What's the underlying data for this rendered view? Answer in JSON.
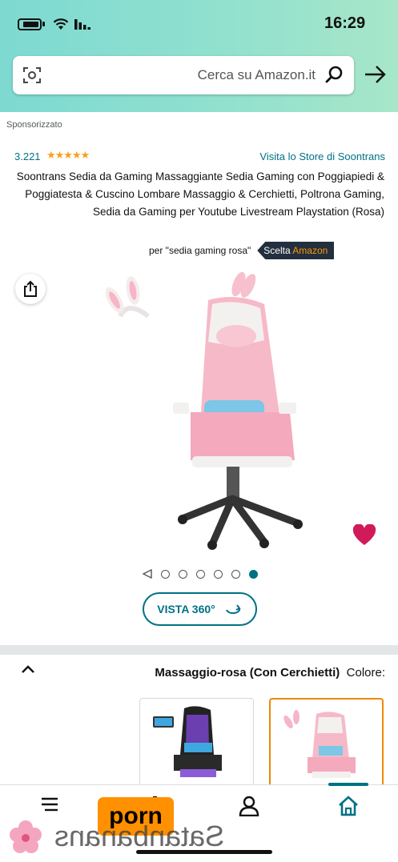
{
  "status_bar": {
    "time": "16:29"
  },
  "search": {
    "placeholder": "Cerca su Amazon.it"
  },
  "sponsor_label": "Sponsorizzato",
  "store_link": "Visita lo Store di Soontrans",
  "rating": {
    "stars": "★★★★★",
    "value": 4.5,
    "count": "3.221"
  },
  "product_title": "Soontrans Sedia da Gaming Massaggiante Sedia Gaming con Poggiapiedi & Poggiatesta & Cuscino Lombare Massaggio & Cerchietti, Poltrona Gaming, Sedia da Gaming per Youtube Livestream Playstation (Rosa)",
  "choice": {
    "badge_prefix": "Scelta ",
    "badge_brand": "Amazon",
    "query_text": "per \"sedia gaming rosa\""
  },
  "carousel": {
    "dot_count": 6,
    "active_index": 0
  },
  "view360": {
    "label": "VISTA 360°"
  },
  "variation": {
    "label": "Colore:",
    "value": "Massaggio-rosa (Con Cerchietti)"
  },
  "watermark": {
    "site": "porn",
    "name": "Satanbanans"
  },
  "colors": {
    "accent": "#007185",
    "badge_bg": "#232f3e",
    "brand": "#ff9900",
    "heart": "#d11a5a",
    "header": "#8ee0cf"
  },
  "icons": [
    "battery-icon",
    "wifi-icon",
    "signal-icon",
    "camera-icon",
    "search-icon",
    "arrow-icon",
    "share-icon",
    "heart-icon",
    "rotate-icon",
    "chevron-up-icon",
    "menu-icon",
    "cart-icon",
    "account-icon",
    "home-icon"
  ]
}
